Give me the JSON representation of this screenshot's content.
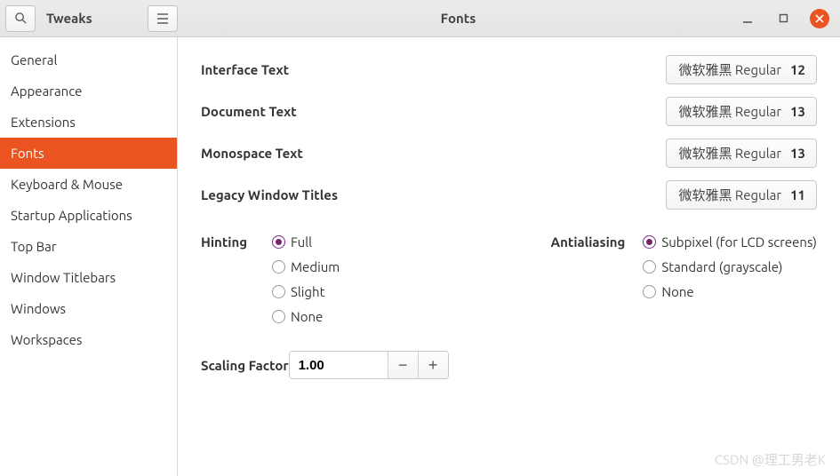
{
  "header": {
    "app_name": "Tweaks",
    "title": "Fonts"
  },
  "sidebar": {
    "items": [
      {
        "label": "General"
      },
      {
        "label": "Appearance"
      },
      {
        "label": "Extensions"
      },
      {
        "label": "Fonts",
        "selected": true
      },
      {
        "label": "Keyboard & Mouse"
      },
      {
        "label": "Startup Applications"
      },
      {
        "label": "Top Bar"
      },
      {
        "label": "Window Titlebars"
      },
      {
        "label": "Windows"
      },
      {
        "label": "Workspaces"
      }
    ]
  },
  "fonts": {
    "rows": [
      {
        "label": "Interface Text",
        "family": "微软雅黑 Regular",
        "size": "12"
      },
      {
        "label": "Document Text",
        "family": "微软雅黑 Regular",
        "size": "13"
      },
      {
        "label": "Monospace Text",
        "family": "微软雅黑 Regular",
        "size": "13"
      },
      {
        "label": "Legacy Window Titles",
        "family": "微软雅黑 Regular",
        "size": "11"
      }
    ]
  },
  "hinting": {
    "label": "Hinting",
    "options": [
      "Full",
      "Medium",
      "Slight",
      "None"
    ],
    "selected": 0
  },
  "antialiasing": {
    "label": "Antialiasing",
    "options": [
      "Subpixel (for LCD screens)",
      "Standard (grayscale)",
      "None"
    ],
    "selected": 0
  },
  "scaling": {
    "label": "Scaling Factor",
    "value": "1.00"
  },
  "watermark": "CSDN @理工男老K"
}
